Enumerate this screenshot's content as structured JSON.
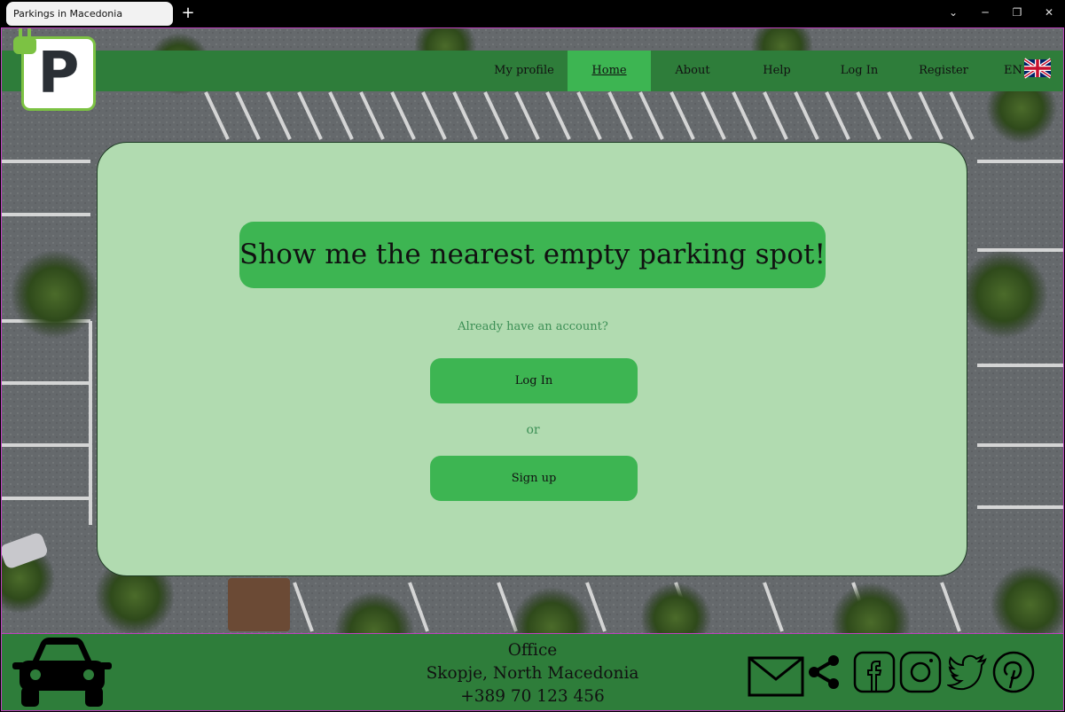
{
  "browser": {
    "tab_title": "Parkings in Macedonia",
    "new_tab": "+",
    "controls": {
      "chevron": "⌄",
      "minimize": "─",
      "maximize": "❐",
      "close": "✕"
    }
  },
  "logo": {
    "letter": "P"
  },
  "nav": {
    "items": [
      {
        "label": "My profile",
        "active": false
      },
      {
        "label": "Home",
        "active": true
      },
      {
        "label": "About",
        "active": false
      },
      {
        "label": "Help",
        "active": false
      },
      {
        "label": "Log In",
        "active": false
      },
      {
        "label": "Register",
        "active": false
      }
    ],
    "language": "EN",
    "flag_icon": "uk-flag-icon"
  },
  "card": {
    "hero_button": "Show me the nearest empty parking spot!",
    "account_question": "Already have an account?",
    "login_button": "Log In",
    "or_text": "or",
    "signup_button": "Sign up"
  },
  "footer": {
    "office_title": "Office",
    "address": "Skopje, North Macedonia",
    "phone": "+389 70 123 456",
    "icons": [
      "car-icon",
      "mail-icon",
      "share-icon",
      "facebook-icon",
      "instagram-icon",
      "twitter-icon",
      "pinterest-icon"
    ]
  },
  "colors": {
    "header_green": "#2e7d3a",
    "accent_green": "#3db552",
    "card_green": "#b1dbb0",
    "logo_border": "#7cc243",
    "muted_text": "#3c8f55"
  }
}
